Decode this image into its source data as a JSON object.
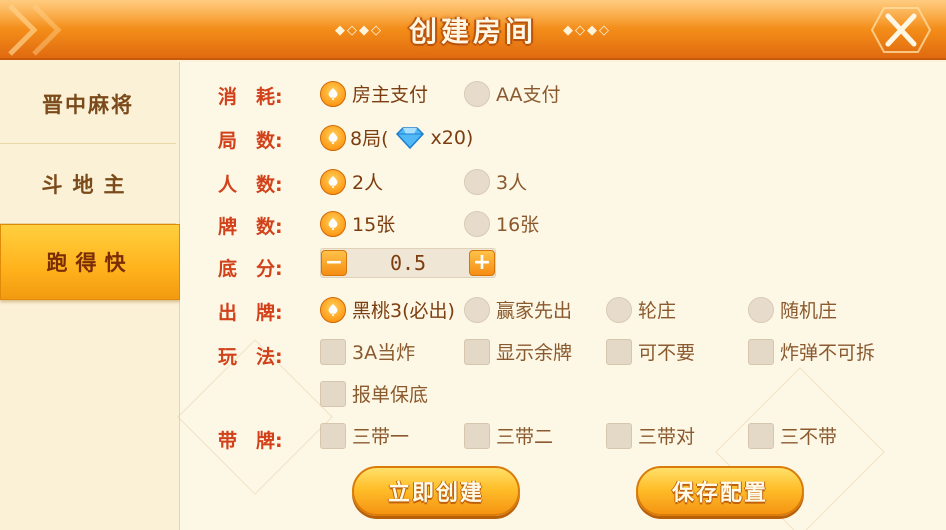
{
  "header": {
    "title": "创建房间",
    "dots_left": "◆◇◆◇",
    "dots_right": "◆◇◆◇"
  },
  "sidebar": {
    "items": [
      {
        "label": "晋中麻将",
        "active": false
      },
      {
        "label": "斗地主",
        "active": false
      },
      {
        "label": "跑得快",
        "active": true
      }
    ]
  },
  "form": {
    "consume": {
      "label": "消　耗:",
      "options": [
        "房主支付",
        "AA支付"
      ],
      "selected": 0
    },
    "rounds": {
      "label": "局　数:",
      "option": "8局(",
      "gem_suffix": "x20)"
    },
    "players": {
      "label": "人　数:",
      "options": [
        "2人",
        "3人"
      ],
      "selected": 0
    },
    "cards": {
      "label": "牌　数:",
      "options": [
        "15张",
        "16张"
      ],
      "selected": 0
    },
    "base": {
      "label": "底　分:",
      "value": "0.5",
      "minus": "−",
      "plus": "+"
    },
    "play_first": {
      "label": "出　牌:",
      "options": [
        "黑桃3(必出)",
        "赢家先出",
        "轮庄",
        "随机庄"
      ],
      "selected": 0
    },
    "rules": {
      "label": "玩　法:",
      "options": [
        "3A当炸",
        "显示余牌",
        "可不要",
        "炸弹不可拆",
        "报单保底"
      ]
    },
    "with_cards": {
      "label": "带　牌:",
      "options": [
        "三带一",
        "三带二",
        "三带对",
        "三不带"
      ]
    }
  },
  "buttons": {
    "create": "立即创建",
    "save": "保存配置"
  },
  "colors": {
    "header": "#f28a18",
    "label": "#d2421a",
    "accent": "#ffb21c"
  }
}
